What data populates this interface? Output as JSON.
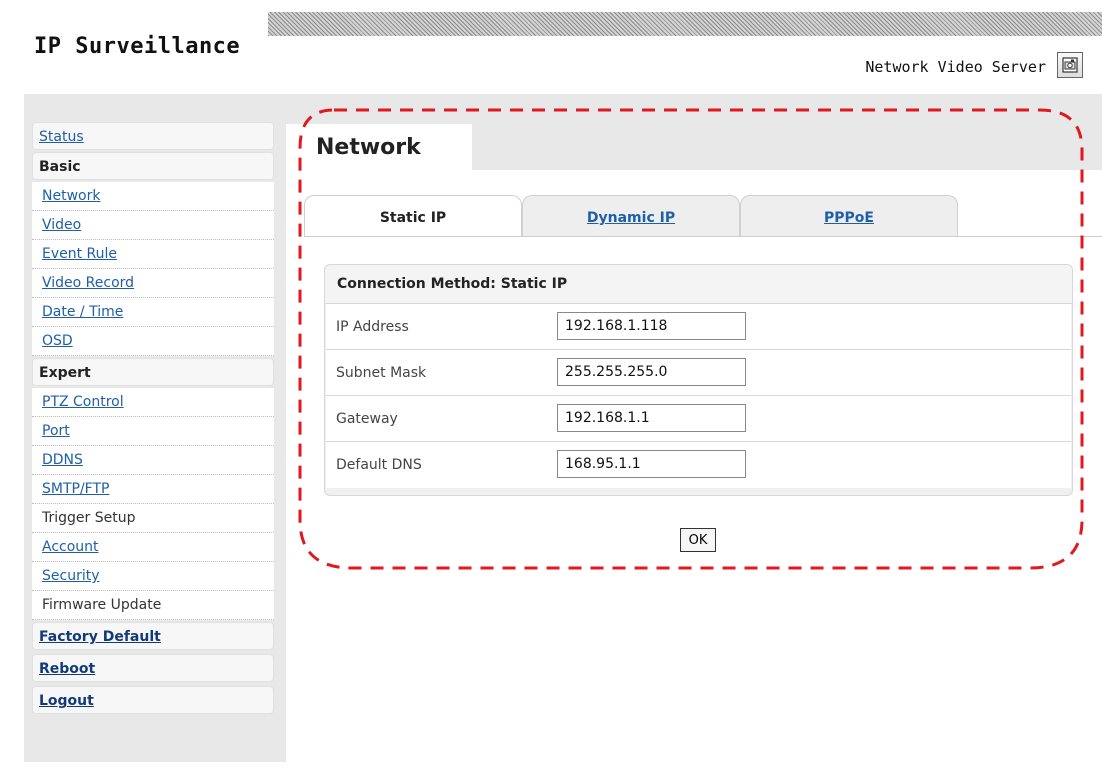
{
  "header": {
    "app_title": "IP Surveillance",
    "product_name": "Network Video Server",
    "snapshot_icon": "camera-snapshot-icon"
  },
  "sidebar": {
    "status": "Status",
    "basic": {
      "heading": "Basic",
      "items": [
        "Network",
        "Video",
        "Event Rule",
        "Video Record",
        "Date / Time",
        "OSD"
      ]
    },
    "expert": {
      "heading": "Expert",
      "items": [
        "PTZ Control",
        "Port",
        "DDNS",
        "SMTP/FTP",
        "Trigger Setup",
        "Account",
        "Security",
        "Firmware Update"
      ]
    },
    "factory_default": "Factory Default",
    "reboot": "Reboot",
    "logout": "Logout"
  },
  "main": {
    "page_title": "Network",
    "tabs": [
      "Static IP",
      "Dynamic IP",
      "PPPoE"
    ],
    "active_tab": "Static IP",
    "section_title": "Connection Method: Static IP",
    "fields": [
      {
        "label": "IP Address",
        "value": "192.168.1.118"
      },
      {
        "label": "Subnet Mask",
        "value": "255.255.255.0"
      },
      {
        "label": "Gateway",
        "value": "192.168.1.1"
      },
      {
        "label": "Default DNS",
        "value": "168.95.1.1"
      }
    ],
    "ok_label": "OK"
  },
  "colors": {
    "link": "#1f5fa8",
    "highlight": "#e0191f",
    "panel_gray": "#e8e8e8"
  }
}
